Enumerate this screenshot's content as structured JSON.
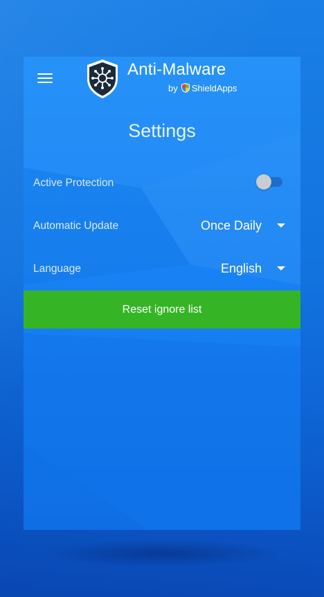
{
  "header": {
    "app_name": "Anti-Malware",
    "by_label": "by",
    "vendor_name": "ShieldApps"
  },
  "page": {
    "title": "Settings"
  },
  "settings": {
    "active_protection": {
      "label": "Active Protection",
      "enabled": false
    },
    "automatic_update": {
      "label": "Automatic Update",
      "value": "Once Daily"
    },
    "language": {
      "label": "Language",
      "value": "English"
    }
  },
  "actions": {
    "reset_ignore_list_label": "Reset ignore list"
  },
  "icons": {
    "menu": "hamburger-menu-icon",
    "logo": "virus-shield-logo-icon",
    "vendor": "colored-shield-icon",
    "dropdown": "caret-down-icon"
  },
  "colors": {
    "background": "#1273df",
    "panel": "#1a86f5",
    "reset_button": "#35b526",
    "toggle_knob": "#c9ccd1"
  }
}
